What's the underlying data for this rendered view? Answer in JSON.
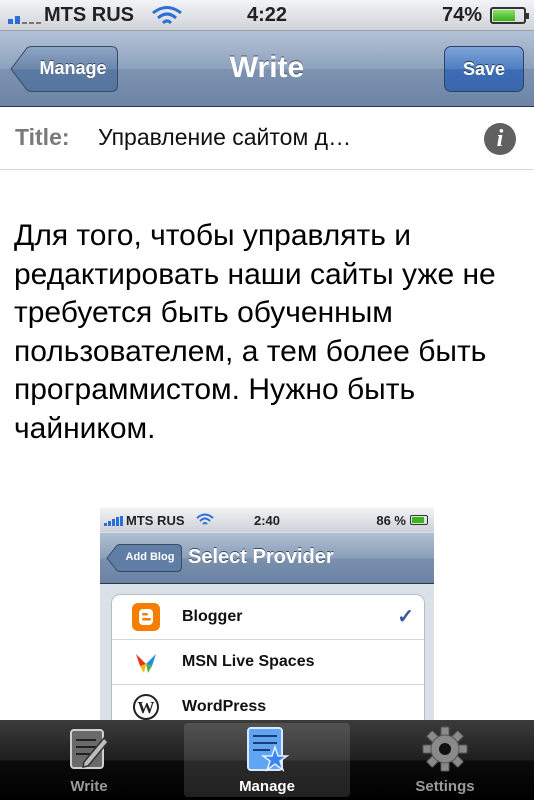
{
  "status_bar": {
    "carrier": "MTS RUS",
    "time": "4:22",
    "battery_percent": "74%",
    "battery_level": 0.74
  },
  "nav": {
    "back_label": "Manage",
    "title": "Write",
    "save_label": "Save"
  },
  "post": {
    "title_label": "Title:",
    "title_value": "Управление сайтом д…",
    "body": "Для того, чтобы управлять и редактировать наши сайты уже не требуется быть обученным пользователем, а тем более быть программистом. Нужно быть чайником."
  },
  "embedded_image": {
    "status": {
      "carrier": "MTS RUS",
      "time": "2:40",
      "battery_percent": "86 %"
    },
    "nav": {
      "back_label": "Add Blog",
      "title": "Select Provider"
    },
    "providers": [
      {
        "name": "Blogger",
        "icon": "blogger-icon",
        "selected": true,
        "check": "✓"
      },
      {
        "name": "MSN Live Spaces",
        "icon": "msn-butterfly-icon",
        "selected": false
      },
      {
        "name": "WordPress",
        "icon": "wordpress-icon",
        "selected": false
      }
    ]
  },
  "tabs": [
    {
      "label": "Write",
      "icon": "write-icon",
      "active": false
    },
    {
      "label": "Manage",
      "icon": "manage-icon",
      "active": true
    },
    {
      "label": "Settings",
      "icon": "gear-icon",
      "active": false
    }
  ],
  "colors": {
    "nav_bar": "#7d93b1",
    "save_button": "#4f7fc2",
    "tab_active": "#3b82f6",
    "blogger": "#f57d00"
  }
}
